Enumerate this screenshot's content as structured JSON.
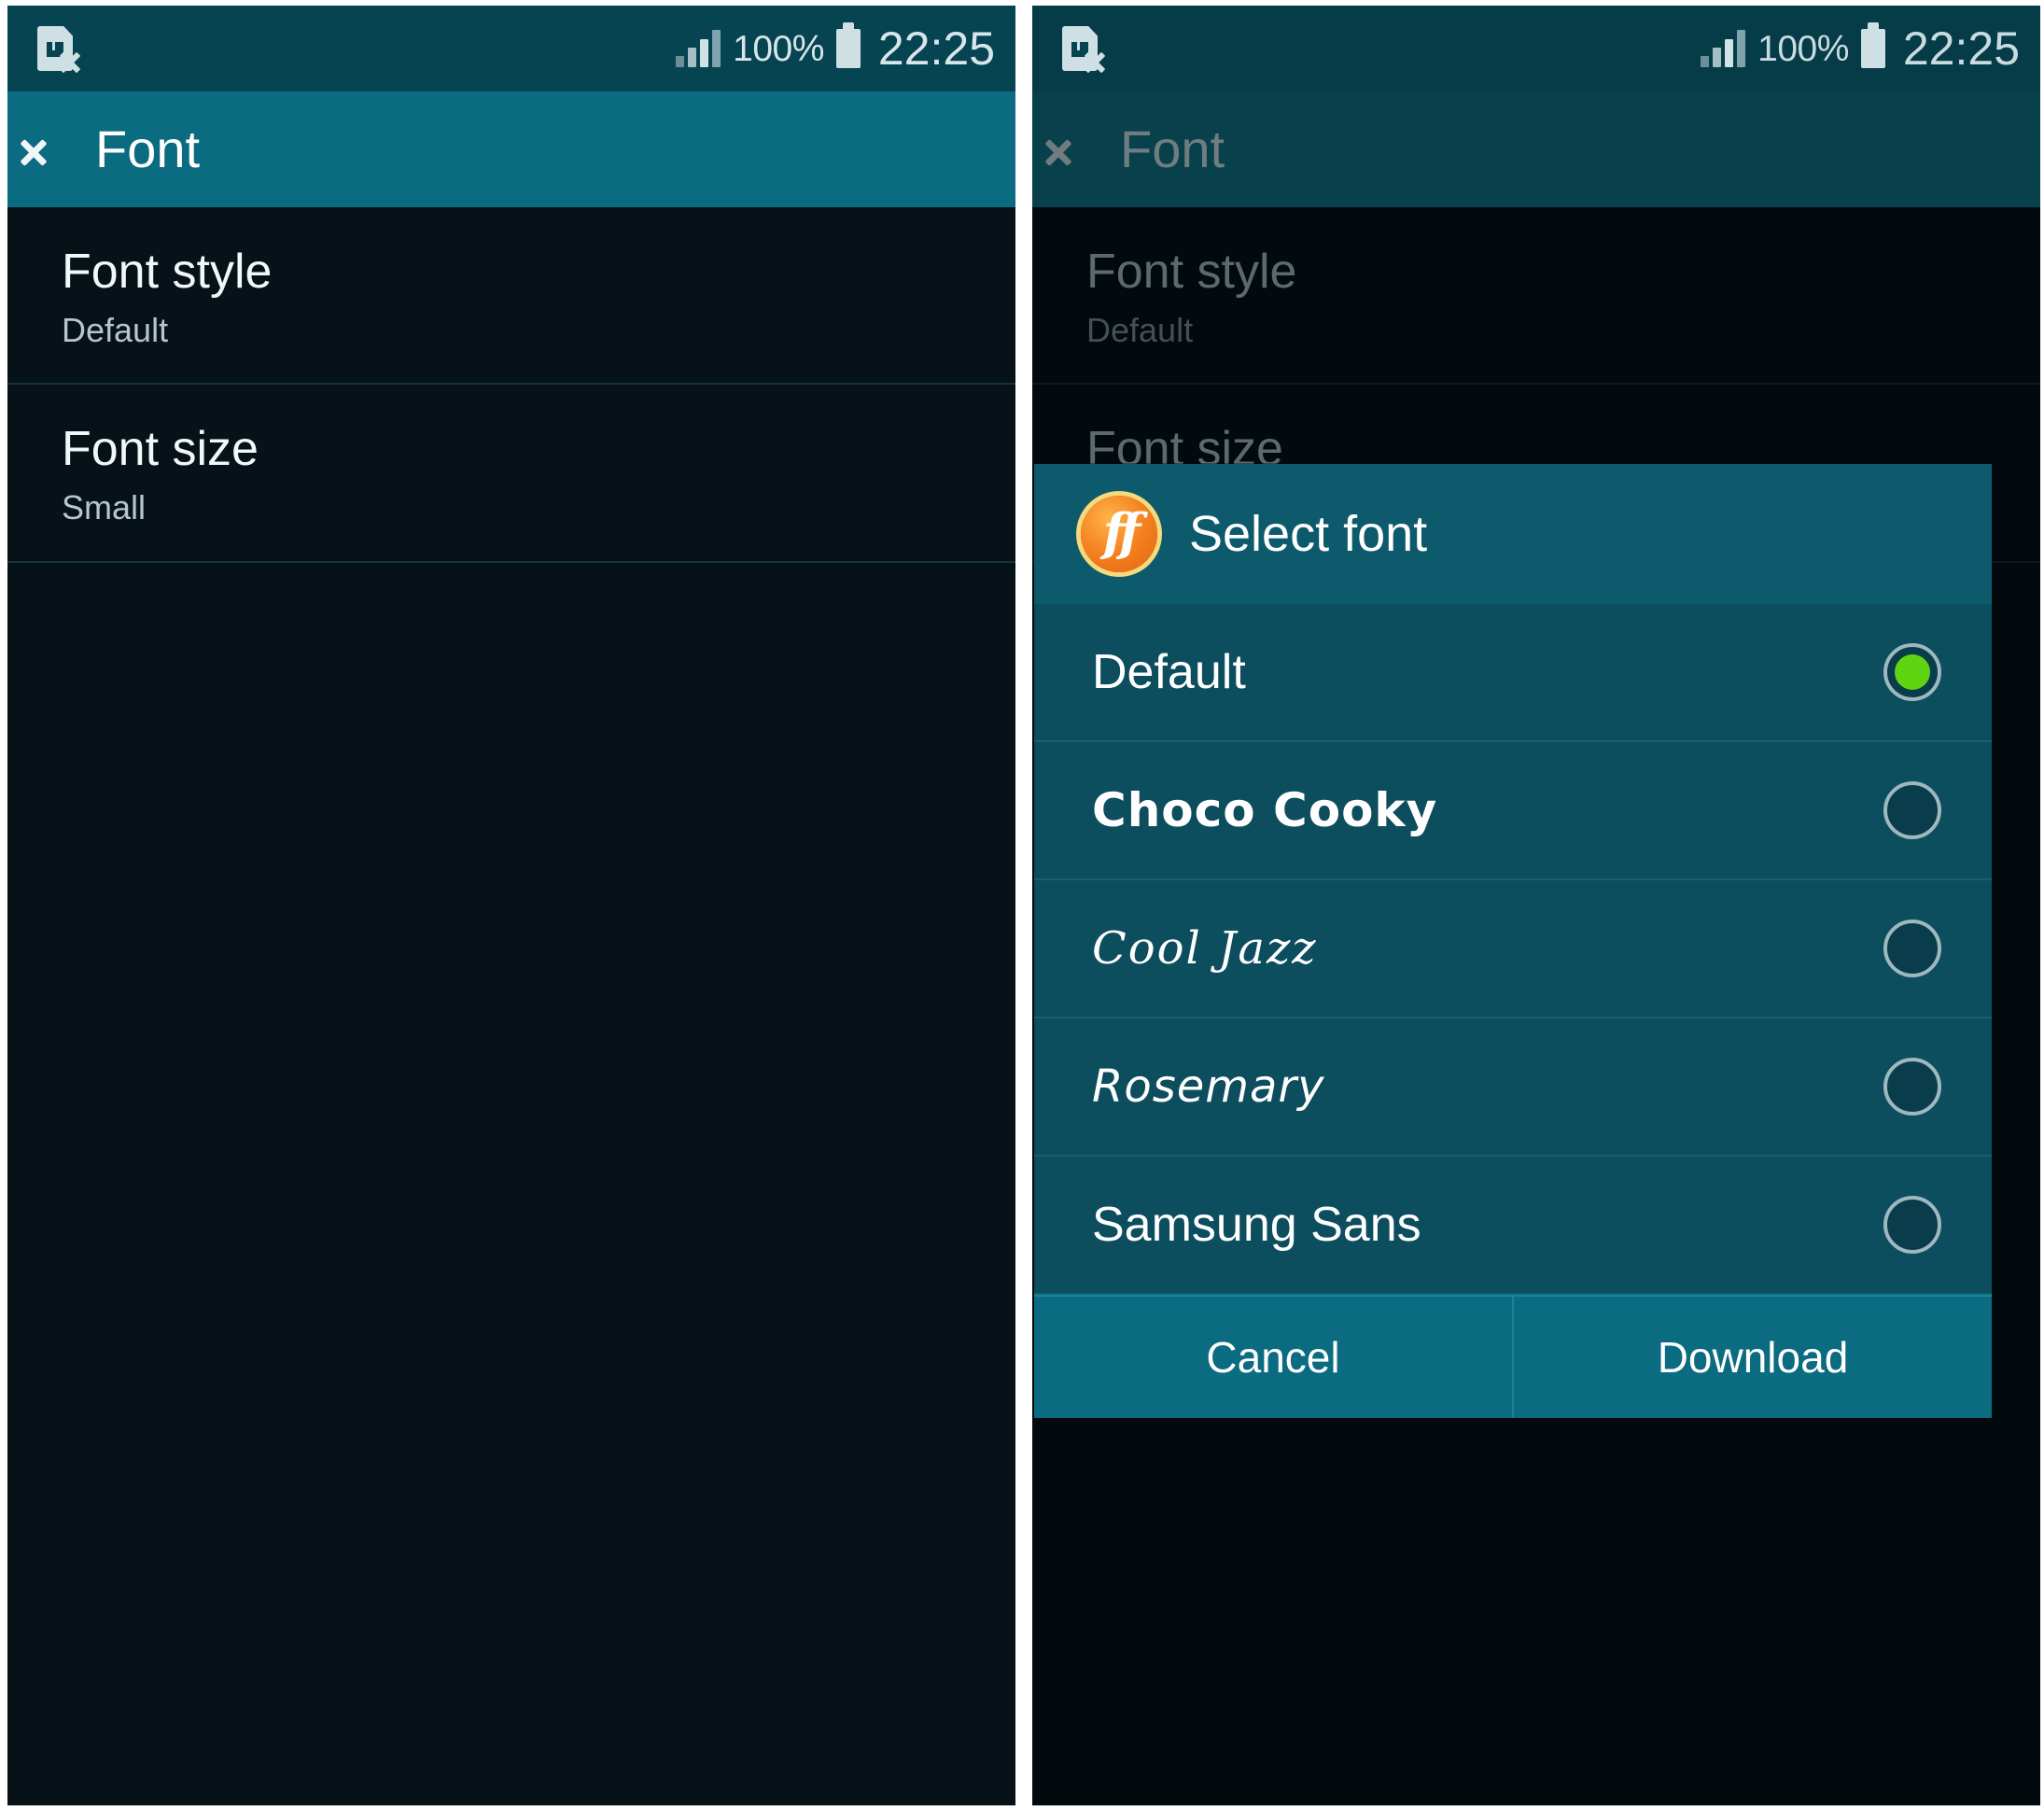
{
  "status_bar": {
    "sim_icon": "no-sim-card-icon",
    "signal_icon": "signal-bars-icon",
    "battery_percent": "100%",
    "battery_icon": "battery-full-icon",
    "time": "22:25"
  },
  "action_bar": {
    "back_icon": "back-chevron-icon",
    "title": "Font"
  },
  "settings": {
    "rows": [
      {
        "title": "Font style",
        "value": "Default"
      },
      {
        "title": "Font size",
        "value": "Small"
      }
    ]
  },
  "dialog": {
    "icon": "ff-font-icon",
    "icon_glyph": "ff",
    "title": "Select font",
    "options": [
      {
        "label": "Default",
        "selected": true,
        "style": "style-default"
      },
      {
        "label": "Choco Cooky",
        "selected": false,
        "style": "style-choco"
      },
      {
        "label": "Cool Jazz",
        "selected": false,
        "style": "style-cooljazz"
      },
      {
        "label": "Rosemary",
        "selected": false,
        "style": "style-rosemary"
      },
      {
        "label": "Samsung Sans",
        "selected": false,
        "style": "style-samsung"
      }
    ],
    "buttons": {
      "cancel": "Cancel",
      "download": "Download"
    }
  },
  "colors": {
    "status_bar": "#064451",
    "action_bar": "#0b6b80",
    "list_background": "#061218",
    "dialog_body": "#0c4d5e",
    "dialog_header": "#0d5a6c",
    "dialog_buttons": "#0b6b80",
    "radio_selected": "#5ed510",
    "ff_icon_orange": "#f58220",
    "ff_icon_ring": "#f5d97a"
  }
}
